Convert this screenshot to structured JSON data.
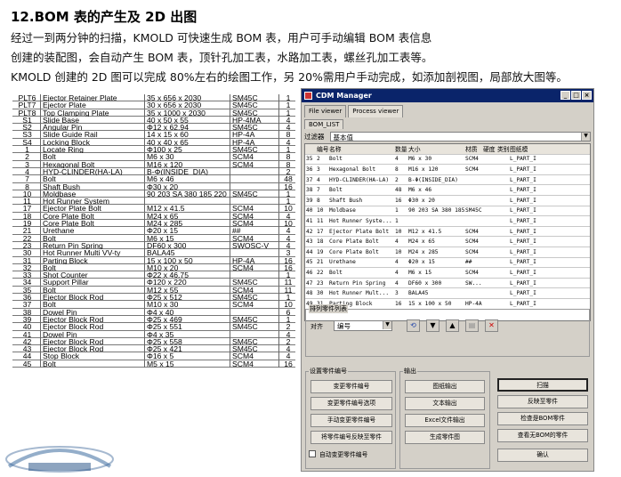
{
  "section": {
    "title": "12.BOM 表的产生及 2D 出图",
    "lines": [
      "经过一到两分钟的扫描，KMOLD 可快速生成 BOM 表，用户可手动编辑 BOM 表信息",
      "创建的装配图，会自动产生 BOM 表，顶针孔加工表，水路加工表，螺丝孔加工表等。",
      "KMOLD 创建的 2D 图可以完成 80%左右的绘图工作，另 20%需用户手动完成，如添加剖视图，局部放大图等。"
    ]
  },
  "bom_sheet": [
    [
      "PLT6",
      "Ejector Retainer Plate",
      "35 x 656 x 2030",
      "SM45C",
      "1"
    ],
    [
      "PLT7",
      "Ejector Plate",
      "30 x 656 x 2030",
      "SM45C",
      "1"
    ],
    [
      "PLT8",
      "Top Clamping Plate",
      "35 x 1000 x 2030",
      "SM45C",
      "1"
    ],
    [
      "S1",
      "Slide Base",
      "40 x 50 x 55",
      "HP-4MA",
      "4"
    ],
    [
      "S2",
      "Angular Pin",
      "Φ12 x 62.94",
      "SM45C",
      "4"
    ],
    [
      "S3",
      "Slide Guide Rail",
      "14 x 15 x 60",
      "HP-4A",
      "8"
    ],
    [
      "S4",
      "Locking Block",
      "40 x 40 x 65",
      "HP-4A",
      "4"
    ],
    [
      "1",
      "Locate Ring",
      "Φ100 x 25",
      "SM45C",
      "1"
    ],
    [
      "2",
      "Bolt",
      "M6 x 30",
      "SCM4",
      "8"
    ],
    [
      "3",
      "Hexagonal Bolt",
      "M16 x 120",
      "SCM4",
      "8"
    ],
    [
      "4",
      "HYD-CLINDER(HA-LA)",
      "B-Φ(INSIDE_DIA)",
      "",
      "2"
    ],
    [
      "7",
      "Bolt",
      "M6 x 46",
      "",
      "48"
    ],
    [
      "8",
      "Shaft Bush",
      "Φ30 x 20",
      "",
      "16"
    ],
    [
      "10",
      "Moldbase",
      "90 203 SA 380 185 220",
      "SM45C",
      "1"
    ],
    [
      "11",
      "Hot Runner System",
      "",
      "",
      "1"
    ],
    [
      "17",
      "Ejector Plate Bolt",
      "M12 x 41.5",
      "SCM4",
      "10"
    ],
    [
      "18",
      "Core Plate Bolt",
      "M24 x 65",
      "SCM4",
      "4"
    ],
    [
      "19",
      "Core Plate Bolt",
      "M24 x 285",
      "SCM4",
      "10"
    ],
    [
      "21",
      "Urethane",
      "Φ20 x 15",
      "##",
      "4"
    ],
    [
      "22",
      "Bolt",
      "M6 x 15",
      "SCM4",
      "4"
    ],
    [
      "23",
      "Return Pin Spring",
      "DF60 x 300",
      "SWOSC-V",
      "4"
    ],
    [
      "30",
      "Hot Runner Multi VV-ty",
      "BALA45",
      "",
      "3"
    ],
    [
      "31",
      "Parting Block",
      "15 x 100 x 50",
      "HP-4A",
      "16"
    ],
    [
      "32",
      "Bolt",
      "M10 x 20",
      "SCM4",
      "16"
    ],
    [
      "33",
      "Shot Counter",
      "Φ22 x 46.75",
      "",
      "1"
    ],
    [
      "34",
      "Support Pillar",
      "Φ120 x 220",
      "SM45C",
      "11"
    ],
    [
      "35",
      "Bolt",
      "M12 x 55",
      "SCM4",
      "11"
    ],
    [
      "36",
      "Ejector Block Rod",
      "Φ25 x 512",
      "SM45C",
      "1"
    ],
    [
      "37",
      "Bolt",
      "M10 x 30",
      "SCM4",
      "10"
    ],
    [
      "38",
      "Dowel Pin",
      "Φ4 x 40",
      "",
      "6"
    ],
    [
      "39",
      "Ejector Block Rod",
      "Φ25 x 469",
      "SM45C",
      "1"
    ],
    [
      "40",
      "Ejector Block Rod",
      "Φ25 x 551",
      "SM45C",
      "2"
    ],
    [
      "41",
      "Dowel Pin",
      "Φ4 x 35",
      "",
      "4"
    ],
    [
      "42",
      "Ejector Block Rod",
      "Φ25 x 558",
      "SM45C",
      "2"
    ],
    [
      "43",
      "Ejector Block Rod",
      "Φ25 x 421",
      "SM45C",
      "4"
    ],
    [
      "44",
      "Stop Block",
      "Φ16 x 5",
      "SCM4",
      "4"
    ],
    [
      "45",
      "Bolt",
      "M5 x 15",
      "SCM4",
      "16"
    ]
  ],
  "dialog": {
    "title": "CDM Manager",
    "tabs": [
      "File viewer",
      "Process viewer"
    ],
    "subtab": "BOM_LIST",
    "filter_label": "过滤器",
    "filter_value": "基本值",
    "columns": [
      "",
      "编号",
      "名称",
      "数量",
      "大小",
      "材质",
      "硬度",
      "类别",
      "图纸模"
    ],
    "rows": [
      [
        "35",
        "2",
        "Bolt",
        "4",
        "M6 x 30",
        "SCM4",
        "",
        "",
        "L_PART_I"
      ],
      [
        "36",
        "3",
        "Hexagonal Bolt",
        "8",
        "M16 x 120",
        "SCM4",
        "",
        "",
        "L_PART_I"
      ],
      [
        "37",
        "4",
        "HYD-CLINDER(HA-LA)",
        "2",
        "B-Φ(INSIDE_DIA)",
        "",
        "",
        "",
        "L_PART_I"
      ],
      [
        "38",
        "7",
        "Bolt",
        "48",
        "M6 x 46",
        "",
        "",
        "",
        "L_PART_I"
      ],
      [
        "39",
        "8",
        "Shaft Bush",
        "16",
        "Φ30 x 20",
        "",
        "",
        "",
        "L_PART_I"
      ],
      [
        "40",
        "10",
        "Moldbase",
        "1",
        "90 203 SA 380 185 220",
        "SM45C",
        "",
        "",
        "L_PART_I"
      ],
      [
        "41",
        "11",
        "Hot Runner Syste...",
        "1",
        "",
        "",
        "",
        "",
        "L_PART_I"
      ],
      [
        "42",
        "17",
        "Ejector Plate Bolt",
        "10",
        "M12 x 41.5",
        "SCM4",
        "",
        "",
        "L_PART_I"
      ],
      [
        "43",
        "18",
        "Core Plate Bolt",
        "4",
        "M24 x 65",
        "SCM4",
        "",
        "",
        "L_PART_I"
      ],
      [
        "44",
        "19",
        "Core Plate Bolt",
        "10",
        "M24 x 285",
        "SCM4",
        "",
        "",
        "L_PART_I"
      ],
      [
        "45",
        "21",
        "Urethane",
        "4",
        "Φ20 x 15",
        "##",
        "",
        "",
        "L_PART_I"
      ],
      [
        "46",
        "22",
        "Bolt",
        "4",
        "M6 x 15",
        "SCM4",
        "",
        "",
        "L_PART_I"
      ],
      [
        "47",
        "23",
        "Return Pin Spring",
        "4",
        "DF60 x 300",
        "SW...",
        "",
        "",
        "L_PART_I"
      ],
      [
        "48",
        "30",
        "Hot Runner Mult...",
        "3",
        "BALA45",
        "",
        "",
        "",
        "L_PART_I"
      ],
      [
        "49",
        "31",
        "Parting Block",
        "16",
        "15 x 100 x 50",
        "HP-4A",
        "",
        "",
        "L_PART_I"
      ]
    ],
    "sort_group": "排列零件列表",
    "sort_label": "对齐",
    "sort_value": "编号",
    "left_group": "设置零件编号",
    "left_buttons": [
      "变更零件编号",
      "变更零件编号选项",
      "手动变更零件编号",
      "将零件编号反映至零件"
    ],
    "middle_group": "输出",
    "middle_buttons": [
      "图纸输出",
      "文本输出",
      "Excel文件输出",
      "生成零件图"
    ],
    "right_buttons": [
      "扫描",
      "反映至零件",
      "检查是BOM零件",
      "查看无BOM的零件",
      "确认"
    ],
    "checkbox_label": "自动变更零件编号"
  }
}
